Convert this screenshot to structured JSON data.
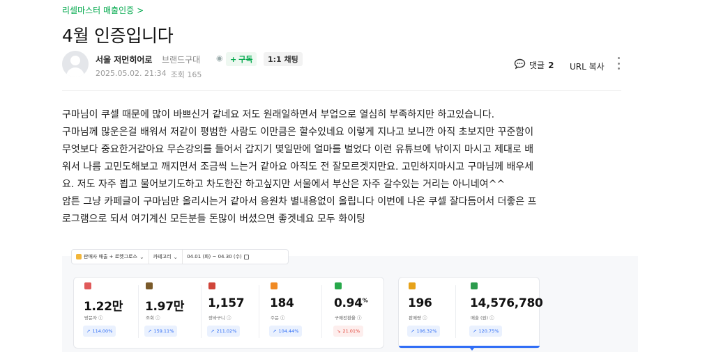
{
  "breadcrumb": {
    "label": "리셀마스터 매출인증",
    "chevron": ">"
  },
  "post": {
    "title": "4월 인증입니다",
    "author": "서울 저먼히어로",
    "grade": "브랜드구대",
    "subscribe_label": "구독",
    "chat_label": "1:1 채팅",
    "date": "2025.05.02. 21:34",
    "views": "조회 165",
    "comment_label": "댓글",
    "comment_count": "2",
    "url_copy_label": "URL 복사"
  },
  "content": {
    "lines": [
      "구마님이 쿠셀 때문에 많이 바쁘신거 같네요 저도 원래일하면서 부업으로 열심히 부족하지만 하고있습니다.",
      "구마님께 많운은걸 배워서 저같이 평범한 사람도 이만큼은 할수있네요 이렇게 지나고 보니깐 아직 초보지만 꾸준함이",
      "무엇보다 중요한거같아요 무슨강의를 들어서 갑지기 몇일만에 얼마를 벌었다 이런 유튜브에 낚이지 마시고 제대로 배",
      "워서 나름 고민도해보고 깨지면서 조금씩  느는거 같아요 아직도 전 잘모르겟지만요. 고민하지마시고 구마님께 배우세",
      "요. 저도 자주 뵙고 물어보기도하고 차도한잔 하고싶지만 서울에서 부산은 자주 갈수있는 거리는 아니네여^^",
      "암튼 그냥 카페글이 구마님만 올리시는거 같아서 응원차 별내용없이 올립니다 이번에 나온 쿠셀 잘다듬어서 더좋은 프",
      "로그램으로 되서 여기계신 모든분들 돈많이 버셨으면 좋겟네요 모두 화이팅"
    ]
  },
  "dashboard": {
    "filter": {
      "channel": "판매사 매출 + 로켓그로스",
      "category": "카테고리",
      "date_range": "04.01 (화) ~ 04.30 (수)"
    },
    "metrics": [
      {
        "icon": "visitor-icon",
        "color": "#e05a5a",
        "value": "1.22만",
        "label": "방문자 ⓘ",
        "change": "114.00%",
        "dir": "up"
      },
      {
        "icon": "eye-icon",
        "color": "#7a5a2a",
        "value": "1.97만",
        "label": "조회 ⓘ",
        "change": "159.11%",
        "dir": "up"
      },
      {
        "icon": "cart-icon",
        "color": "#d0453a",
        "value": "1,157",
        "label": "장바구니 ⓘ",
        "change": "211.02%",
        "dir": "up"
      },
      {
        "icon": "order-icon",
        "color": "#f08a24",
        "value": "184",
        "label": "주문 ⓘ",
        "change": "104.44%",
        "dir": "up"
      },
      {
        "icon": "conversion-icon",
        "color": "#27a84a",
        "value": "0.94",
        "value_suffix": "%",
        "label": "구매전환율 ⓘ",
        "change": "21.01%",
        "dir": "down"
      },
      {
        "icon": "sales-qty-icon",
        "color": "#e6a21a",
        "value": "196",
        "label": "판매량 ⓘ",
        "change": "106.32%",
        "dir": "up"
      },
      {
        "icon": "revenue-icon",
        "color": "#2c9b4d",
        "value": "14,576,780",
        "label": "매출 (원) ⓘ",
        "change": "120.75%",
        "dir": "up"
      }
    ]
  }
}
